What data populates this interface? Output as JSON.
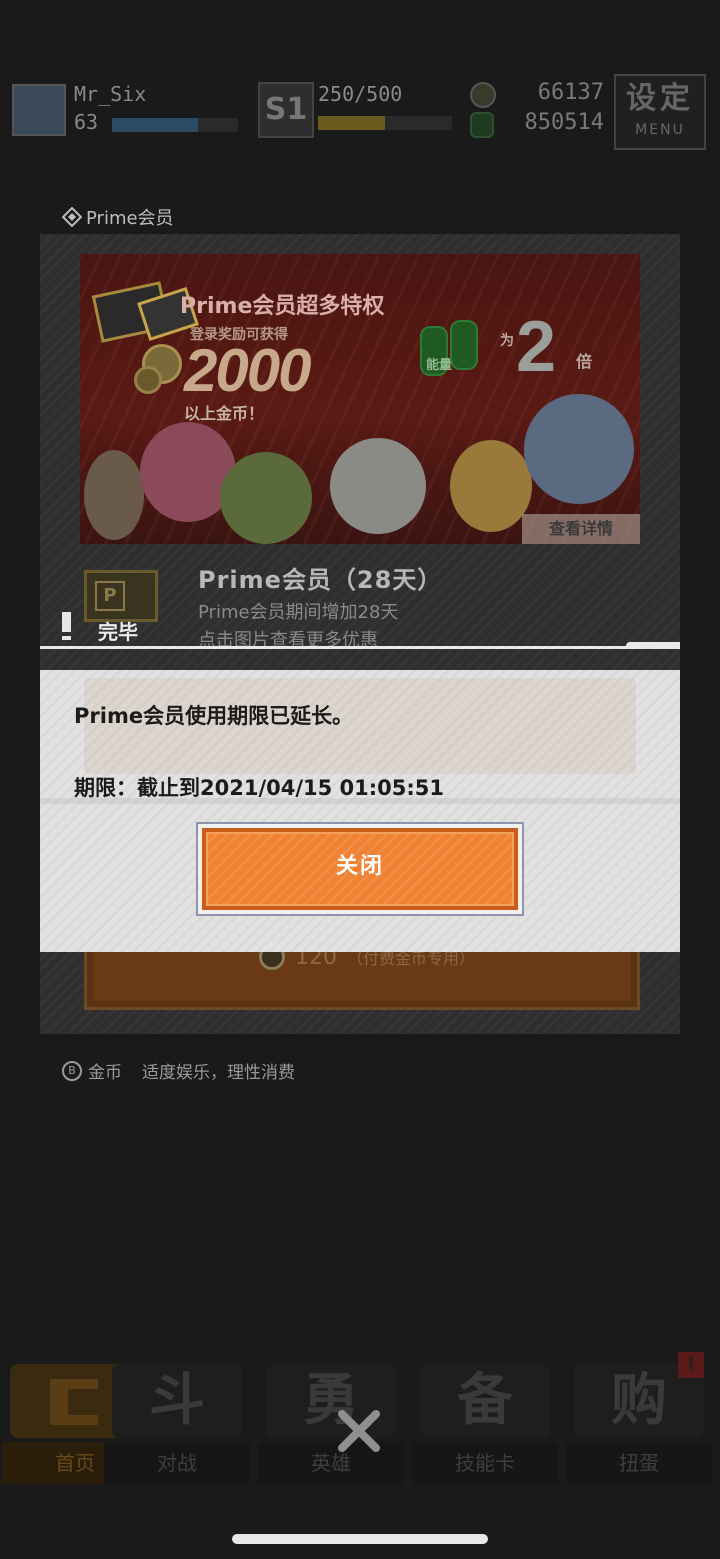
{
  "topbar": {
    "player_name": "Mr_Six",
    "player_level": "63",
    "level_progress": 0.68,
    "rank_label": "S1",
    "stamina": "250/500",
    "stamina_progress": 0.5,
    "coins": "66137",
    "energy": "850514",
    "menu_big": "设定",
    "menu_small": "MENU"
  },
  "section": {
    "title": "Prime会员"
  },
  "banner": {
    "title": "Prime会员超多特权",
    "subtitle": "登录奖励可获得",
    "amount": "2000",
    "amount_suffix": "以上金币！",
    "energy_label": "能量",
    "multiplier_prefix": "为",
    "multiplier": "2",
    "multiplier_suffix": "倍",
    "detail_button": "查看详情"
  },
  "item": {
    "title": "Prime会员（28天）",
    "desc1": "Prime会员期间增加28天",
    "desc2": "点击图片查看更多优惠"
  },
  "status": {
    "done_label": "完毕"
  },
  "purchase": {
    "price": "120",
    "price_note": "（付费金币专用）"
  },
  "dialog": {
    "message": "Prime会员使用期限已延长。",
    "expiry": "期限：截止到2021/04/15 01:05:51",
    "close_label": "关闭"
  },
  "footer": {
    "coin_label": "金币",
    "notice": "适度娱乐，理性消费"
  },
  "nav": {
    "items": [
      {
        "label": "首页",
        "glyph": ""
      },
      {
        "label": "对战",
        "glyph": "斗"
      },
      {
        "label": "英雄",
        "glyph": "勇"
      },
      {
        "label": "技能卡",
        "glyph": "备"
      },
      {
        "label": "扭蛋",
        "glyph": "购"
      }
    ],
    "badge": "!"
  },
  "colors": {
    "dialog_button": "#f08233",
    "dialog_bg": "#e8e8e8",
    "panel_bg": "#2f2f2f",
    "accent_done": "#e9e9e9"
  }
}
